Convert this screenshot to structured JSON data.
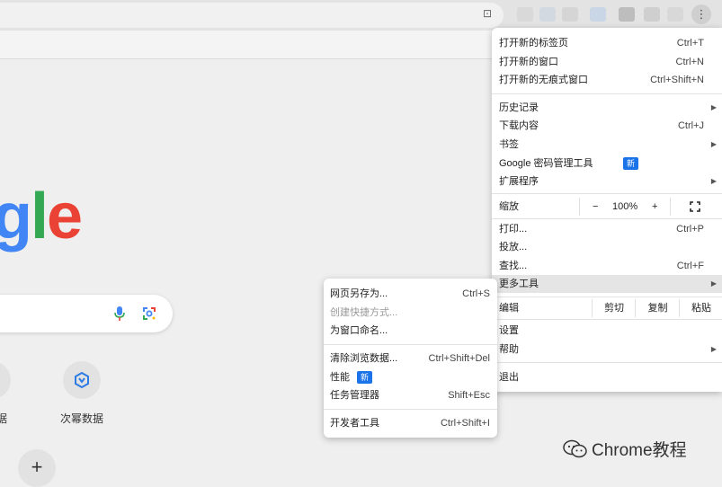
{
  "main_menu": {
    "items": [
      {
        "label": "打开新的标签页",
        "shortcut": "Ctrl+T"
      },
      {
        "label": "打开新的窗口",
        "shortcut": "Ctrl+N"
      },
      {
        "label": "打开新的无痕式窗口",
        "shortcut": "Ctrl+Shift+N"
      },
      {
        "label": "历史记录",
        "shortcut": ""
      },
      {
        "label": "下载内容",
        "shortcut": "Ctrl+J"
      },
      {
        "label": "书签",
        "shortcut": ""
      },
      {
        "label": "Google 密码管理工具",
        "badge": "新"
      },
      {
        "label": "扩展程序",
        "shortcut": ""
      },
      {
        "label": "打印...",
        "shortcut": "Ctrl+P"
      },
      {
        "label": "投放...",
        "shortcut": ""
      },
      {
        "label": "查找...",
        "shortcut": "Ctrl+F"
      },
      {
        "label": "更多工具",
        "shortcut": ""
      },
      {
        "label": "设置",
        "shortcut": ""
      },
      {
        "label": "帮助",
        "shortcut": ""
      },
      {
        "label": "退出",
        "shortcut": ""
      }
    ],
    "zoom": {
      "label": "缩放",
      "minus": "−",
      "value": "100%",
      "plus": "+"
    },
    "edit": {
      "label": "编辑",
      "cut": "剪切",
      "copy": "复制",
      "paste": "粘贴"
    }
  },
  "submenu": {
    "items": [
      {
        "label": "网页另存为...",
        "shortcut": "Ctrl+S"
      },
      {
        "label": "创建快捷方式...",
        "shortcut": ""
      },
      {
        "label": "为窗口命名...",
        "shortcut": ""
      },
      {
        "label": "清除浏览数据...",
        "shortcut": "Ctrl+Shift+Del"
      },
      {
        "label": "性能",
        "badge": "新"
      },
      {
        "label": "任务管理器",
        "shortcut": "Shift+Esc"
      },
      {
        "label": "开发者工具",
        "shortcut": "Ctrl+Shift+I"
      }
    ]
  },
  "newtab": {
    "logo_g": "g",
    "logo_l": "l",
    "logo_e": "e",
    "shortcut_label_left": "据",
    "shortcut_label": "次幂数据",
    "add_symbol": "+"
  },
  "watermark": {
    "text": "Chrome教程"
  },
  "colors": {
    "accent": "#1a73e8",
    "menu_bg": "#ffffff",
    "page_bg": "#efefef"
  }
}
